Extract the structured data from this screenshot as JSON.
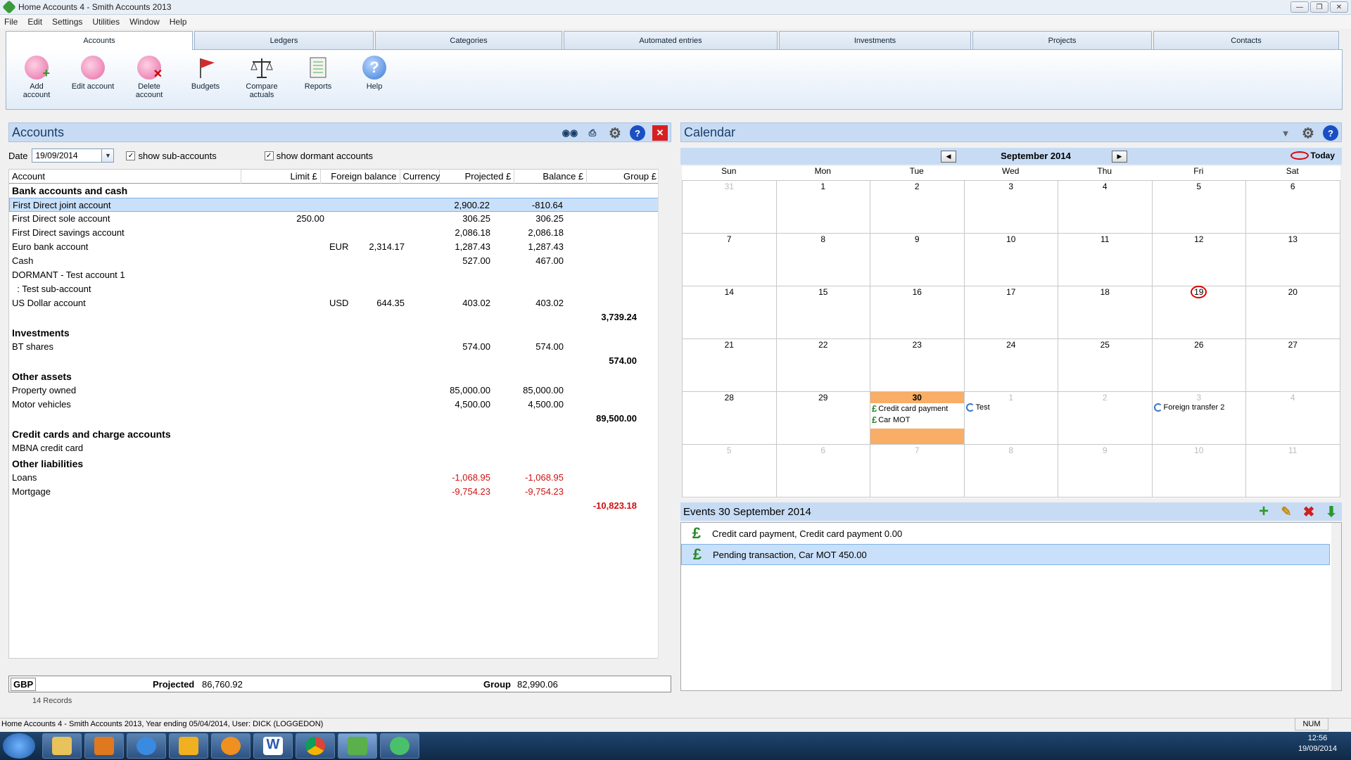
{
  "window": {
    "title": "Home Accounts 4 - Smith Accounts 2013"
  },
  "menu": [
    "File",
    "Edit",
    "Settings",
    "Utilities",
    "Window",
    "Help"
  ],
  "tabs": [
    "Accounts",
    "Ledgers",
    "Categories",
    "Automated entries",
    "Investments",
    "Projects",
    "Contacts"
  ],
  "ribbon": {
    "add": "Add\naccount",
    "edit": "Edit account",
    "delete": "Delete\naccount",
    "budgets": "Budgets",
    "compare": "Compare\nactuals",
    "reports": "Reports",
    "help": "Help"
  },
  "accounts": {
    "title": "Accounts",
    "date_label": "Date",
    "date_value": "19/09/2014",
    "show_sub": "show sub-accounts",
    "show_dormant": "show dormant accounts",
    "columns": [
      "Account",
      "Limit £",
      "Foreign balance",
      "Currency",
      "Projected £",
      "Balance £",
      "Group £"
    ],
    "groups": [
      {
        "name": "Bank accounts and cash",
        "total": "3,739.24",
        "rows": [
          {
            "name": "First Direct joint account",
            "limit": "",
            "foreign": "",
            "currency": "",
            "projected": "2,900.22",
            "balance": "-810.64"
          },
          {
            "name": "First Direct sole account",
            "limit": "250.00",
            "foreign": "",
            "currency": "",
            "projected": "306.25",
            "balance": "306.25"
          },
          {
            "name": "First Direct savings account",
            "limit": "",
            "foreign": "",
            "currency": "",
            "projected": "2,086.18",
            "balance": "2,086.18"
          },
          {
            "name": "Euro bank account",
            "limit": "",
            "foreign": "2,314.17",
            "currency": "EUR",
            "projected": "1,287.43",
            "balance": "1,287.43"
          },
          {
            "name": "Cash",
            "limit": "",
            "foreign": "",
            "currency": "",
            "projected": "527.00",
            "balance": "467.00"
          },
          {
            "name": "DORMANT - Test account 1",
            "limit": "",
            "foreign": "",
            "currency": "",
            "projected": "",
            "balance": ""
          },
          {
            "name": "  : Test sub-account",
            "limit": "",
            "foreign": "",
            "currency": "",
            "projected": "",
            "balance": ""
          },
          {
            "name": "US Dollar account",
            "limit": "",
            "foreign": "644.35",
            "currency": "USD",
            "projected": "403.02",
            "balance": "403.02"
          }
        ]
      },
      {
        "name": "Investments",
        "total": "574.00",
        "rows": [
          {
            "name": "BT shares",
            "limit": "",
            "foreign": "",
            "currency": "",
            "projected": "574.00",
            "balance": "574.00"
          }
        ]
      },
      {
        "name": "Other assets",
        "total": "89,500.00",
        "rows": [
          {
            "name": "Property owned",
            "limit": "",
            "foreign": "",
            "currency": "",
            "projected": "85,000.00",
            "balance": "85,000.00"
          },
          {
            "name": "Motor vehicles",
            "limit": "",
            "foreign": "",
            "currency": "",
            "projected": "4,500.00",
            "balance": "4,500.00"
          }
        ]
      },
      {
        "name": "Credit cards and charge accounts",
        "total": "",
        "rows": [
          {
            "name": "MBNA credit card",
            "limit": "",
            "foreign": "",
            "currency": "",
            "projected": "",
            "balance": ""
          }
        ]
      },
      {
        "name": "Other liabilities",
        "total": "-10,823.18",
        "rows": [
          {
            "name": "Loans",
            "limit": "",
            "foreign": "",
            "currency": "",
            "projected": "-1,068.95",
            "balance": "-1,068.95"
          },
          {
            "name": "Mortgage",
            "limit": "",
            "foreign": "",
            "currency": "",
            "projected": "-9,754.23",
            "balance": "-9,754.23"
          }
        ]
      }
    ],
    "footer": {
      "currency": "GBP",
      "projected_label": "Projected",
      "projected": "86,760.92",
      "group_label": "Group",
      "group": "82,990.06"
    },
    "records": "14 Records"
  },
  "calendar": {
    "title": "Calendar",
    "month": "September 2014",
    "today": "Today",
    "dow": [
      "Sun",
      "Mon",
      "Tue",
      "Wed",
      "Thu",
      "Fri",
      "Sat"
    ],
    "weeks": [
      [
        "31",
        "1",
        "2",
        "3",
        "4",
        "5",
        "6"
      ],
      [
        "7",
        "8",
        "9",
        "10",
        "11",
        "12",
        "13"
      ],
      [
        "14",
        "15",
        "16",
        "17",
        "18",
        "19",
        "20"
      ],
      [
        "21",
        "22",
        "23",
        "24",
        "25",
        "26",
        "27"
      ],
      [
        "28",
        "29",
        "30",
        "1",
        "2",
        "3",
        "4"
      ],
      [
        "5",
        "6",
        "7",
        "8",
        "9",
        "10",
        "11"
      ]
    ],
    "events": {
      "tue30": [
        "Credit card payment",
        "Car MOT"
      ],
      "wed1": "Test",
      "fri3": "Foreign transfer 2"
    }
  },
  "events_panel": {
    "title": "Events 30 September 2014",
    "items": [
      "Credit card payment, Credit card payment 0.00",
      "Pending transaction, Car MOT 450.00"
    ]
  },
  "status": {
    "text": "Home Accounts 4 - Smith Accounts 2013, Year ending 05/04/2014, User: DICK (LOGGEDON)",
    "num": "NUM"
  },
  "clock": {
    "time": "12:56",
    "date": "19/09/2014"
  }
}
